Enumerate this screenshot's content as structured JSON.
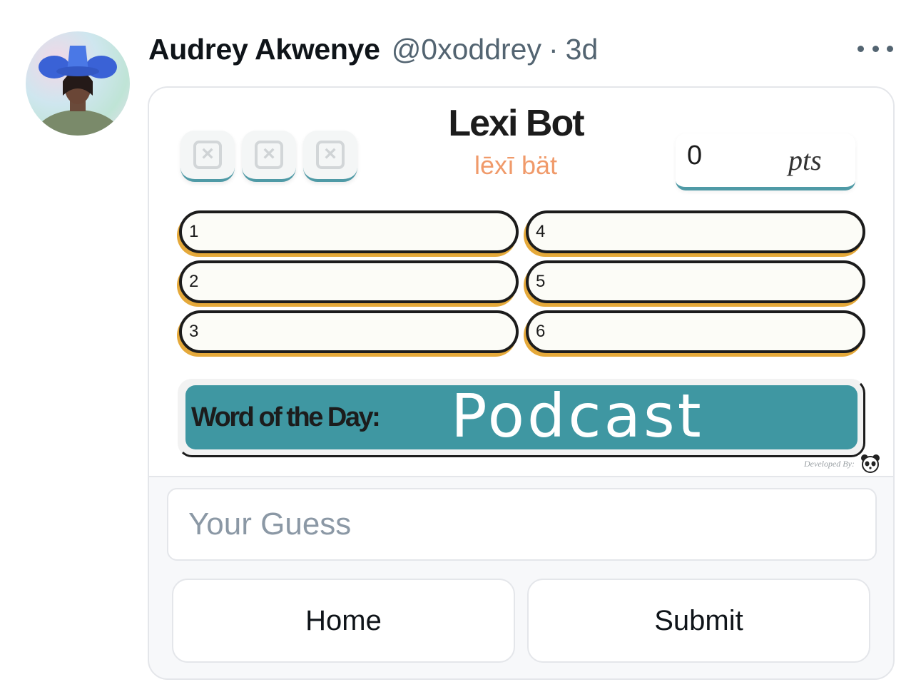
{
  "tweet": {
    "author_name": "Audrey Akwenye",
    "handle": "@0xoddrey",
    "separator": "·",
    "time": "3d"
  },
  "frame": {
    "title": "Lexi Bot",
    "subtitle": "lēxī bät",
    "strike_icons": [
      "x-box-icon",
      "x-box-icon",
      "x-box-icon"
    ],
    "score": {
      "value": "0",
      "unit": "pts"
    },
    "slots": [
      {
        "num": "1"
      },
      {
        "num": "2"
      },
      {
        "num": "3"
      },
      {
        "num": "4"
      },
      {
        "num": "5"
      },
      {
        "num": "6"
      }
    ],
    "word_of_day_label": "Word of the Day:",
    "word_of_day": "Podcast",
    "credit": "Developed By:",
    "colors": {
      "teal": "#3f97a2",
      "orange": "#f09a6a",
      "gold": "#e5a93a"
    }
  },
  "input": {
    "placeholder": "Your Guess"
  },
  "buttons": {
    "home": "Home",
    "submit": "Submit"
  }
}
